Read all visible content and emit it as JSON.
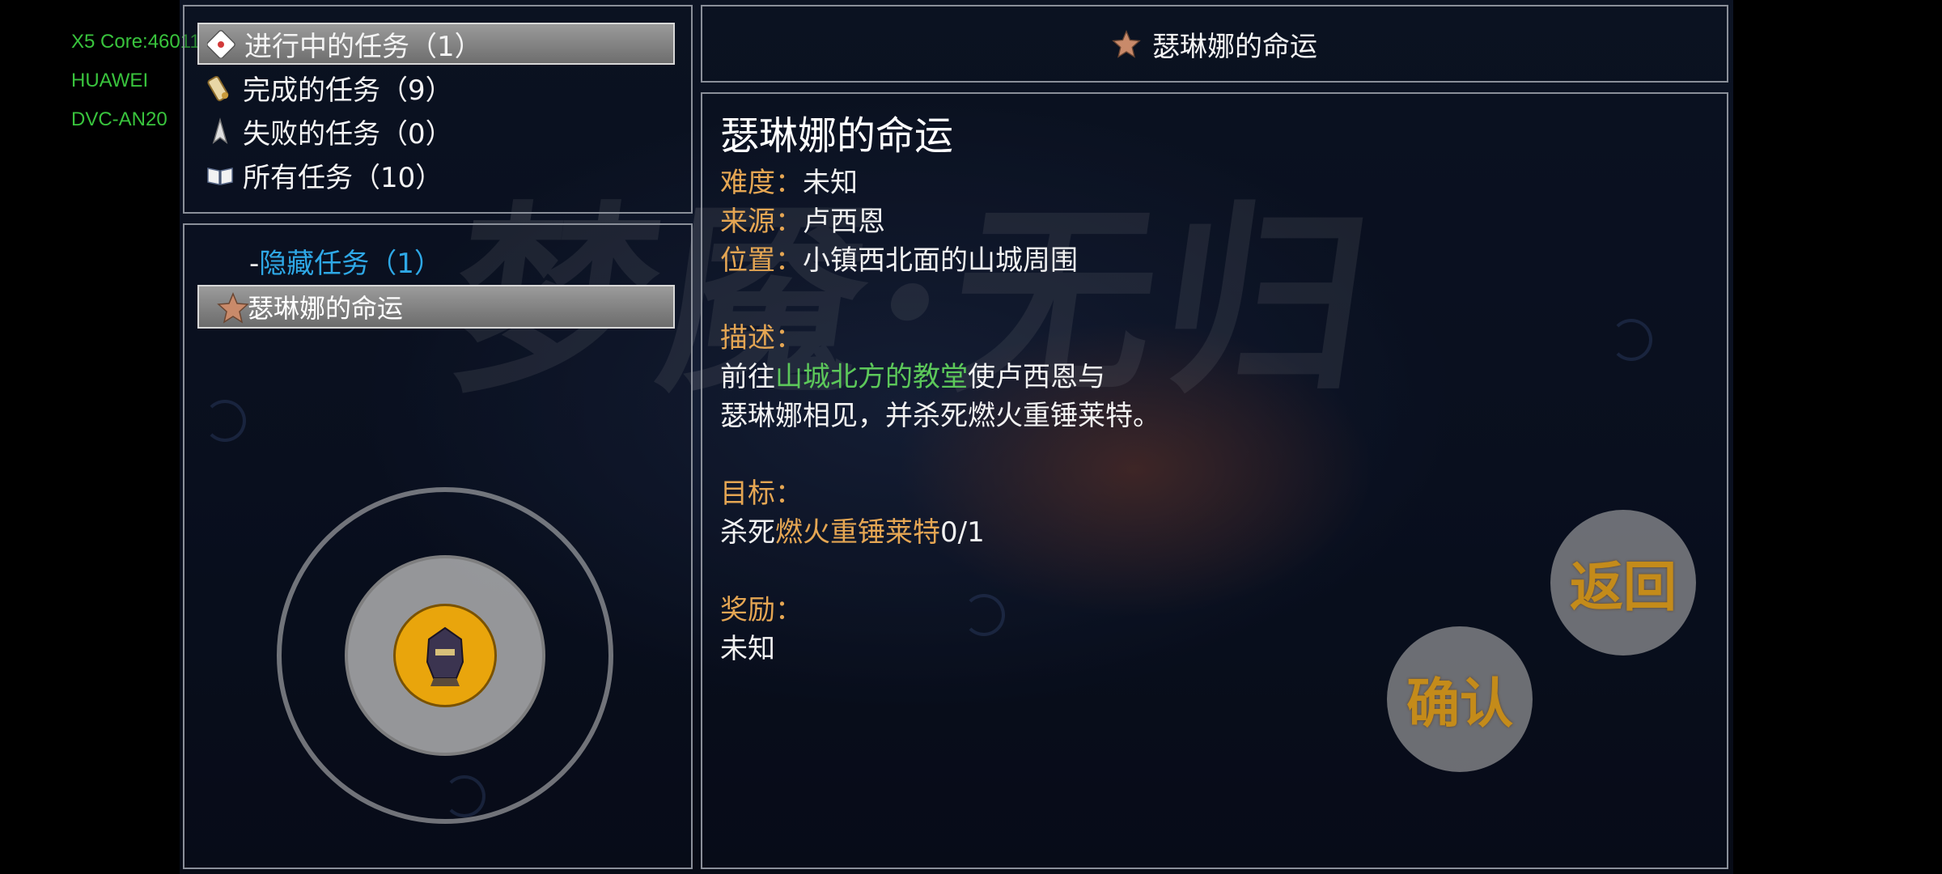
{
  "device_info": {
    "line1": "X5 Core:46011",
    "line2": "HUAWEI",
    "line3": "DVC-AN20"
  },
  "watermark": "梦魇·无归",
  "categories": [
    {
      "label": "进行中的任务（1）",
      "icon": "envelope-icon",
      "selected": true
    },
    {
      "label": "完成的任务（9）",
      "icon": "scroll-icon",
      "selected": false
    },
    {
      "label": "失败的任务（0）",
      "icon": "sword-icon",
      "selected": false
    },
    {
      "label": "所有任务（10）",
      "icon": "book-icon",
      "selected": false
    }
  ],
  "quest_list": {
    "group_prefix": "-",
    "group_label": "隐藏任务（1）",
    "quests": [
      {
        "label": "瑟琳娜的命运",
        "icon": "star-icon"
      }
    ]
  },
  "header": {
    "title": "瑟琳娜的命运",
    "icon": "star-icon"
  },
  "detail": {
    "title": "瑟琳娜的命运",
    "difficulty_label": "难度：",
    "difficulty_value": "未知",
    "source_label": "来源：",
    "source_value": "卢西恩",
    "location_label": "位置：",
    "location_value": "小镇西北面的山城周围",
    "description_label": "描述：",
    "description_prefix": "前往",
    "description_highlight": "山城北方的教堂",
    "description_suffix": "使卢西恩与",
    "description_line2": "瑟琳娜相见，并杀死燃火重锤莱特。",
    "objective_label": "目标：",
    "objective_prefix": "杀死",
    "objective_target": "燃火重锤莱特",
    "objective_progress": "0/1",
    "reward_label": "奖励：",
    "reward_value": "未知"
  },
  "buttons": {
    "back": "返回",
    "confirm": "确认"
  },
  "colors": {
    "label": "#e5a653",
    "highlight_green": "#5cc85a",
    "group_blue": "#2ea8e6",
    "device_text": "#39c43d",
    "joystick_knob": "#e9a50c"
  }
}
